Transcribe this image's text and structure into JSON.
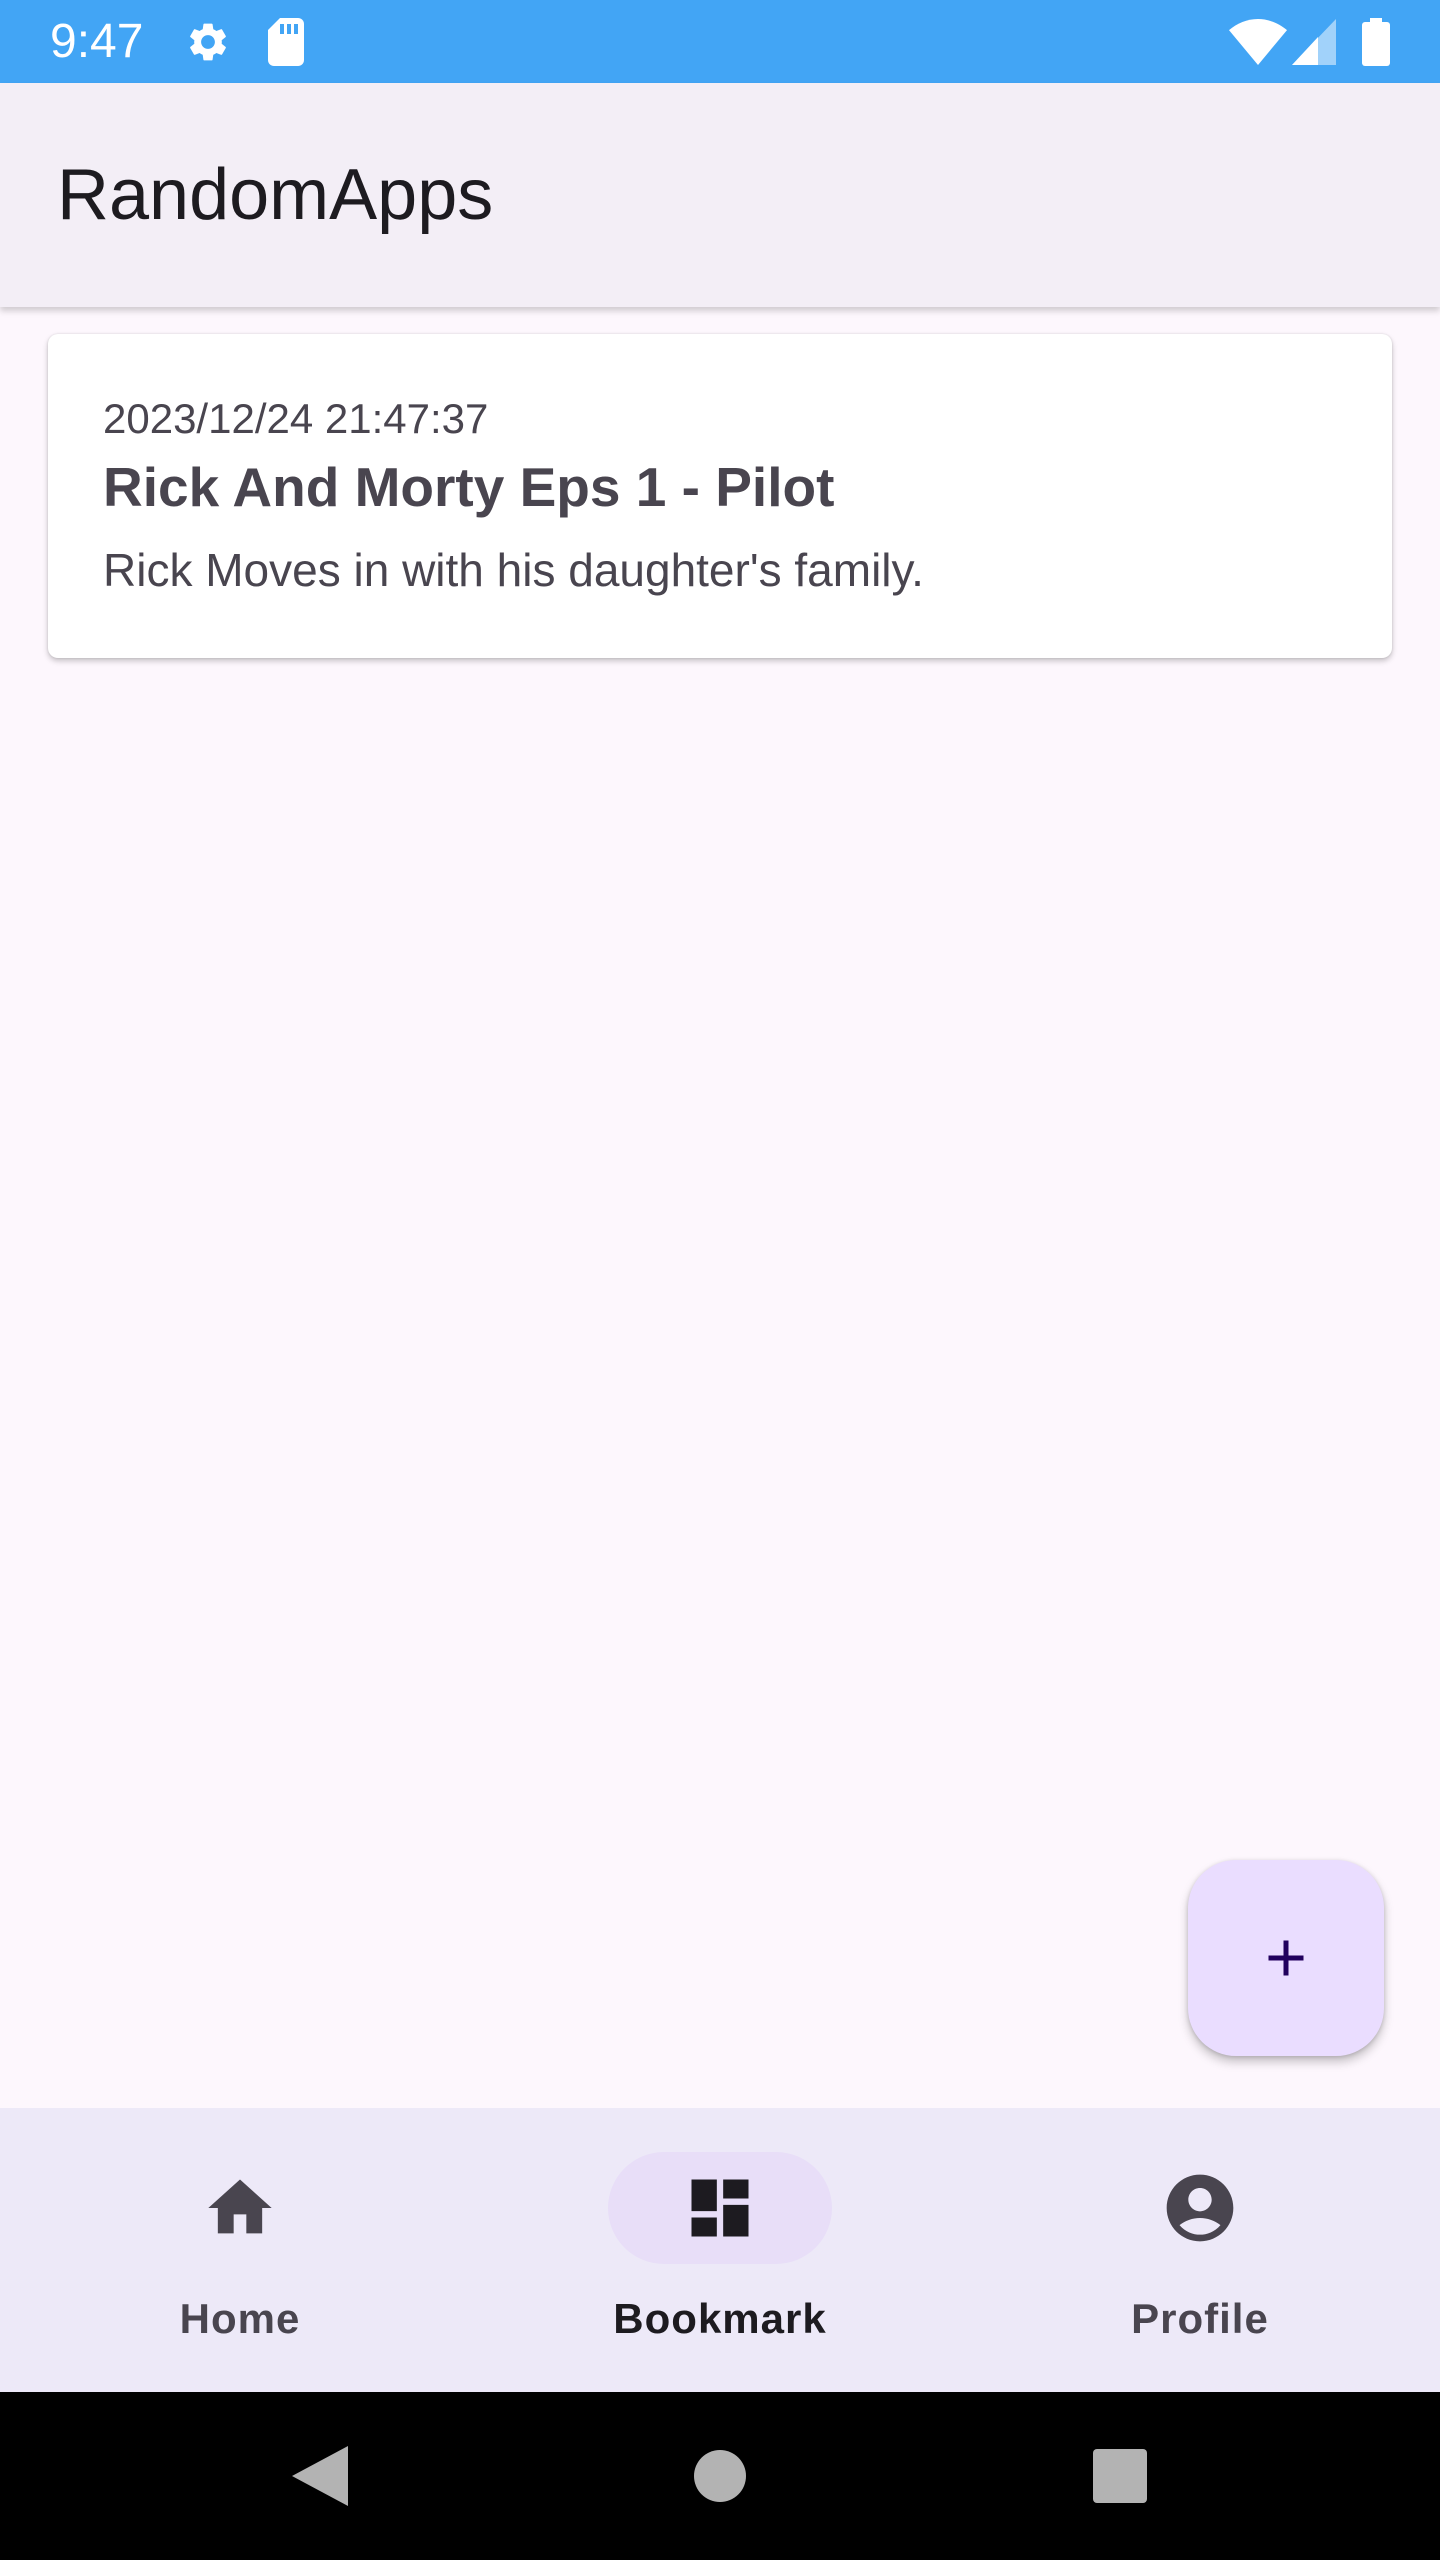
{
  "status_bar": {
    "time": "9:47",
    "icons": [
      "gear-icon",
      "sd-card-icon",
      "wifi-icon",
      "cell-signal-icon",
      "battery-icon"
    ]
  },
  "app_bar": {
    "title": "RandomApps"
  },
  "bookmarks": [
    {
      "timestamp": "2023/12/24 21:47:37",
      "title": "Rick And Morty Eps 1 - Pilot",
      "description": "Rick Moves in with his daughter's family."
    }
  ],
  "fab": {
    "icon": "plus-icon"
  },
  "bottom_nav": {
    "items": [
      {
        "label": "Home",
        "icon": "home-icon",
        "active": false
      },
      {
        "label": "Bookmark",
        "icon": "dashboard-icon",
        "active": true
      },
      {
        "label": "Profile",
        "icon": "account-circle-icon",
        "active": false
      }
    ]
  },
  "system_nav": {
    "icons": [
      "back-icon",
      "home-circle-icon",
      "recents-icon"
    ]
  },
  "colors": {
    "status_bar": "#42a5f5",
    "app_bar": "#f3eef6",
    "background": "#fdf7fd",
    "fab": "#eaddff",
    "nav_bar": "#ede9f8",
    "nav_indicator": "#e8def8"
  }
}
